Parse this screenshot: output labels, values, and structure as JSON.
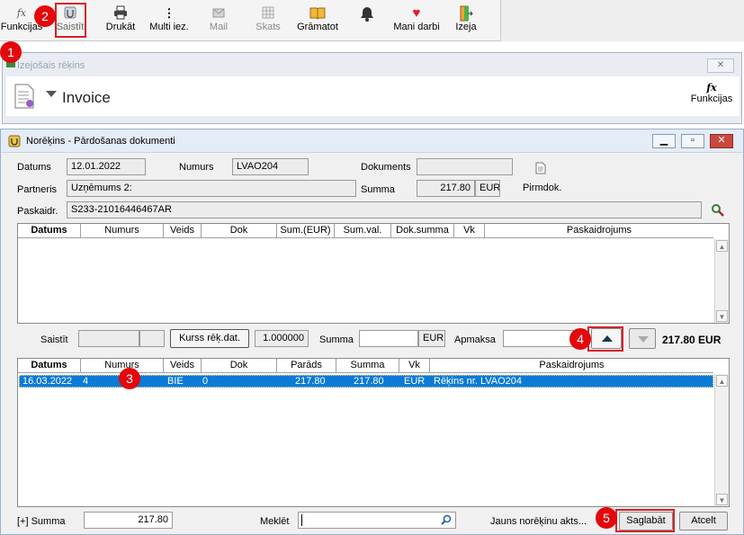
{
  "toolbar": {
    "items": [
      {
        "label": "Funkcijas",
        "icon": "fx-icon"
      },
      {
        "label": "Saistīt",
        "icon": "link-icon"
      },
      {
        "label": "Drukāt",
        "icon": "printer-icon"
      },
      {
        "label": "Multi iez.",
        "icon": "more-icon"
      },
      {
        "label": "Mail",
        "icon": "mail-icon"
      },
      {
        "label": "Skats",
        "icon": "view-icon"
      },
      {
        "label": "Grāmatot",
        "icon": "book-icon"
      },
      {
        "label": "",
        "icon": "bell-icon"
      },
      {
        "label": "Mani darbi",
        "icon": "heart-icon"
      },
      {
        "label": "Izeja",
        "icon": "exit-icon"
      }
    ]
  },
  "outer_window": {
    "title": "Izejošais rēķins",
    "heading": "Invoice",
    "functions_label": "Funkcijas"
  },
  "inner_window": {
    "title": "Norēķins - Pārdošanas dokumenti",
    "datums_label": "Datums",
    "datums_value": "12.01.2022",
    "numurs_label": "Numurs",
    "numurs_value": "LVAO204",
    "dokuments_label": "Dokuments",
    "dokuments_value": "",
    "partneris_label": "Partneris",
    "partneris_value": "Uzņēmums 2:",
    "summa_label": "Summa",
    "summa_value": "217.80",
    "summa_currency": "EUR",
    "pirmdok_label": "Pirmdok.",
    "paskaidr_label": "Paskaidr.",
    "paskaidr_value": "S233-21016446467AR"
  },
  "upper_grid": {
    "columns": [
      "Datums",
      "Numurs",
      "Veids",
      "Dok",
      "Sum.(EUR)",
      "Sum.val.",
      "Dok.summa",
      "Vk",
      "Paskaidrojums"
    ],
    "rows": []
  },
  "middle": {
    "saistit_label": "Saistīt",
    "kurss_button": "Kurss rēķ.dat.",
    "kurss_value": "1.000000",
    "summa_label": "Summa",
    "summa_value": "",
    "summa_currency": "EUR",
    "apmaksa_label": "Apmaksa",
    "apmaksa_value": "",
    "total": "217.80 EUR"
  },
  "lower_grid": {
    "columns": [
      "Datums",
      "Numurs",
      "Veids",
      "Dok",
      "Parāds",
      "Summa",
      "Vk",
      "Paskaidrojums"
    ],
    "rows": [
      {
        "datums": "16.03.2022",
        "numurs": "4",
        "veids": "BIE",
        "dok": "0",
        "parads": "217.80",
        "summa": "217.80",
        "vk": "EUR",
        "paskaidrojums": "Rēķins nr. LVAO204"
      }
    ]
  },
  "footer": {
    "summa_label": "[+] Summa",
    "summa_value": "217.80",
    "meklet_label": "Meklēt",
    "meklet_value": "",
    "jauns_link": "Jauns norēķinu akts...",
    "save_button": "Saglabāt",
    "cancel_button": "Atcelt"
  },
  "markers": [
    "1",
    "2",
    "3",
    "4",
    "5"
  ],
  "colors": {
    "marker": "#e3080b",
    "selection": "#0c7ad7"
  }
}
